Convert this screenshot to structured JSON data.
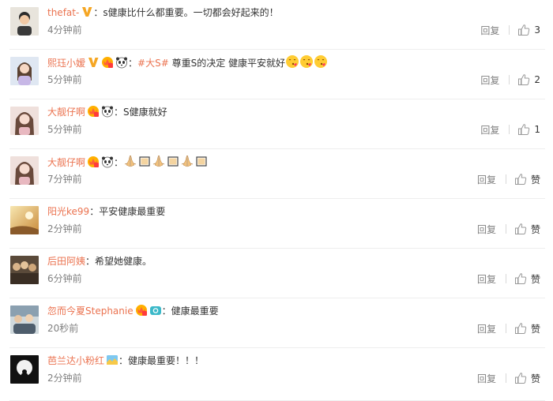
{
  "comments": [
    {
      "username": "thefat-",
      "text": "s健康比什么都重要。一切都会好起来的！",
      "time": "4分钟前",
      "reply_label": "回复",
      "likes": "3",
      "badges": [
        "verified-v-icon"
      ],
      "avatar": "avatar-boy-icon"
    },
    {
      "username": "熙珏小嫒",
      "topic": "#大S#",
      "text": "尊重S的决定  健康平安就好",
      "time": "5分钟前",
      "reply_label": "回复",
      "likes": "2",
      "badges": [
        "verified-v-icon",
        "vip-icon",
        "panda-icon"
      ],
      "avatar": "avatar-girl-icon"
    },
    {
      "username": "大靓仔啊",
      "text": "S健康就好",
      "time": "5分钟前",
      "reply_label": "回复",
      "likes": "1",
      "badges": [
        "vip-icon",
        "panda-icon"
      ],
      "avatar": "avatar-woman-icon"
    },
    {
      "username": "大靓仔啊",
      "text": "",
      "time": "7分钟前",
      "reply_label": "回复",
      "likes": "赞",
      "badges": [
        "vip-icon",
        "panda-icon"
      ],
      "avatar": "avatar-woman-icon"
    },
    {
      "username": "阳光ke99",
      "text": "平安健康最重要",
      "time": "2分钟前",
      "reply_label": "回复",
      "likes": "赞",
      "badges": [],
      "avatar": "avatar-sunset-icon"
    },
    {
      "username": "后田阿姨",
      "text": "希望她健康。",
      "time": "6分钟前",
      "reply_label": "回复",
      "likes": "赞",
      "badges": [],
      "avatar": "avatar-crowd-icon"
    },
    {
      "username": "忽而今夏Stephanie",
      "text": "健康最重要",
      "time": "20秒前",
      "reply_label": "回复",
      "likes": "赞",
      "badges": [
        "vip-icon",
        "camera-icon"
      ],
      "avatar": "avatar-group-icon"
    },
    {
      "username": "芭兰达小粉红",
      "text": "健康最重要！！！",
      "time": "2分钟前",
      "reply_label": "回复",
      "likes": "赞",
      "badges": [
        "landscape-badge-icon"
      ],
      "avatar": "avatar-moon-icon"
    }
  ],
  "colors": {
    "username": "#eb7350",
    "text": "#333333",
    "meta": "#808080",
    "divider": "#eeeeee"
  }
}
